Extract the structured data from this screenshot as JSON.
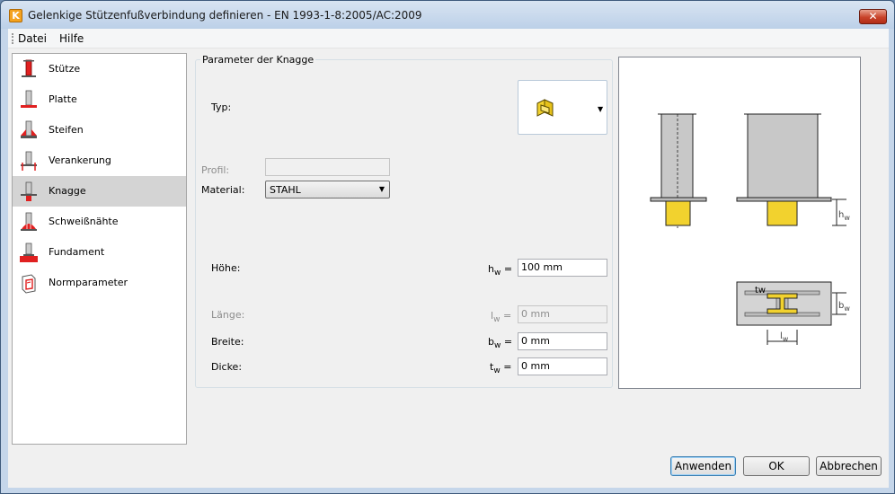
{
  "window": {
    "title": "Gelenkige Stützenfußverbindung definieren - EN 1993-1-8:2005/AC:2009",
    "app_icon_letter": "K",
    "close_glyph": "✕"
  },
  "menu": {
    "items": [
      {
        "label": "Datei"
      },
      {
        "label": "Hilfe"
      }
    ]
  },
  "nav": {
    "selected_index": 4,
    "items": [
      {
        "label": "Stütze",
        "icon": "column-icon"
      },
      {
        "label": "Platte",
        "icon": "plate-icon"
      },
      {
        "label": "Steifen",
        "icon": "stiffener-icon"
      },
      {
        "label": "Verankerung",
        "icon": "anchor-icon"
      },
      {
        "label": "Knagge",
        "icon": "shear-key-icon"
      },
      {
        "label": "Schweißnähte",
        "icon": "weld-icon"
      },
      {
        "label": "Fundament",
        "icon": "foundation-icon"
      },
      {
        "label": "Normparameter",
        "icon": "code-parameters-icon"
      }
    ]
  },
  "params": {
    "group_title": "Parameter der Knagge",
    "typ_label": "Typ:",
    "typ_icon": "shear-key-type-icon",
    "profil_label": "Profil:",
    "profil_value": "",
    "material_label": "Material:",
    "material_value": "STAHL",
    "hoehe_label": "Höhe:",
    "hoehe_sym": "h",
    "hoehe_sub": "w",
    "hoehe_value": "100 mm",
    "laenge_label": "Länge:",
    "laenge_sym": "l",
    "laenge_sub": "w",
    "laenge_value": "0 mm",
    "breite_label": "Breite:",
    "breite_sym": "b",
    "breite_sub": "w",
    "breite_value": "0 mm",
    "dicke_label": "Dicke:",
    "dicke_sym": "t",
    "dicke_sub": "w",
    "dicke_value": "0 mm",
    "eq": "="
  },
  "preview": {
    "hw_label": "h",
    "hw_sub": "w",
    "bw_label": "b",
    "bw_sub": "w",
    "lw_label": "l",
    "lw_sub": "w",
    "tw_label": "tw",
    "colors": {
      "steel": "#c8c8c8",
      "key": "#f2d22e",
      "outline": "#222222"
    }
  },
  "buttons": {
    "apply": "Anwenden",
    "ok": "OK",
    "cancel": "Abbrechen"
  }
}
